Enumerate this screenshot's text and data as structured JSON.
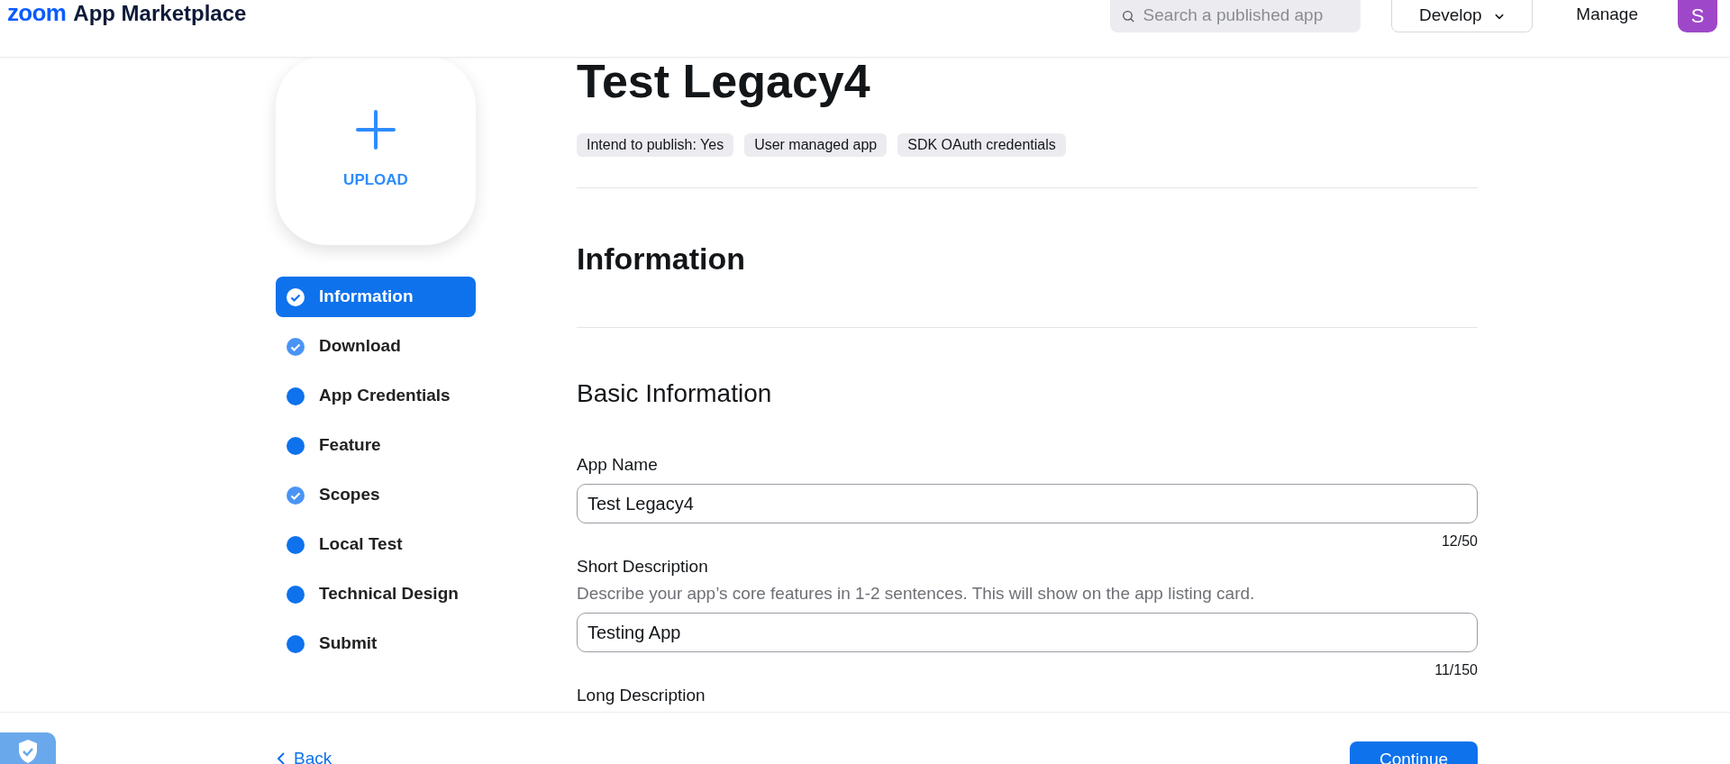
{
  "header": {
    "logo": "zoom",
    "title": "App Marketplace",
    "search": {
      "placeholder": "Search a published app"
    },
    "develop": "Develop",
    "manage": "Manage",
    "avatar": "S"
  },
  "upload": {
    "label": "UPLOAD"
  },
  "nav": [
    {
      "label": "Information",
      "selected": true,
      "done": true
    },
    {
      "label": "Download",
      "selected": false,
      "done": true
    },
    {
      "label": "App Credentials",
      "selected": false,
      "done": false
    },
    {
      "label": "Feature",
      "selected": false,
      "done": false
    },
    {
      "label": "Scopes",
      "selected": false,
      "done": true
    },
    {
      "label": "Local Test",
      "selected": false,
      "done": false
    },
    {
      "label": "Technical Design",
      "selected": false,
      "done": false
    },
    {
      "label": "Submit",
      "selected": false,
      "done": false
    }
  ],
  "app_title": "Test Legacy4",
  "tags": [
    "Intend to publish: Yes",
    "User managed app",
    "SDK OAuth credentials"
  ],
  "section_title": "Information",
  "subsection_title": "Basic Information",
  "fields": [
    {
      "label": "App Name",
      "value": "Test Legacy4",
      "count": "12/50"
    },
    {
      "label": "Short Description",
      "hint": "Describe your app’s core features in 1-2 sentences. This will show on the app listing card.",
      "value": "Testing App",
      "count": "11/150"
    }
  ],
  "next_label": "Long Description",
  "footer": {
    "back": "Back",
    "continue": "Continue"
  }
}
